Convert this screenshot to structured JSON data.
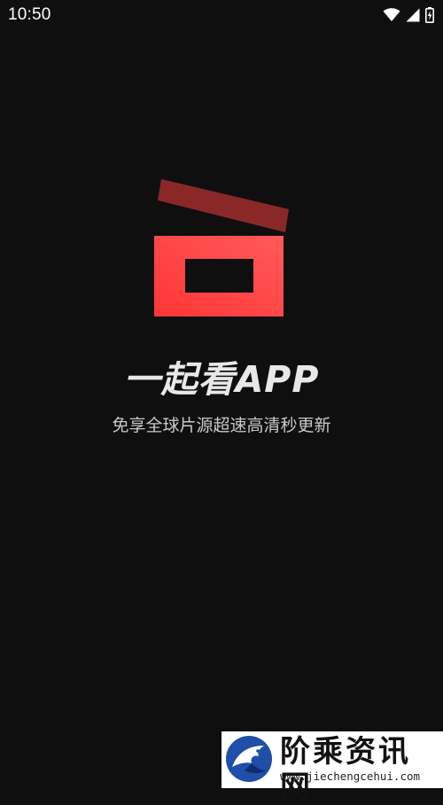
{
  "status_bar": {
    "time": "10:50",
    "icons": [
      "wifi-icon",
      "cell-signal-icon",
      "battery-charging-icon"
    ]
  },
  "splash": {
    "logo": "clapperboard-icon",
    "title": "一起看APP",
    "subtitle": "免享全球片源超速高清秒更新"
  },
  "watermark": {
    "title": "阶乘资讯网",
    "url": "www.jiechengcehui.com"
  },
  "colors": {
    "background": "#0f0f10",
    "logo_red": "#ff4646",
    "logo_dark_red": "#8a2828",
    "text_primary": "#e8e8e8",
    "text_secondary": "#c9c9c9"
  }
}
